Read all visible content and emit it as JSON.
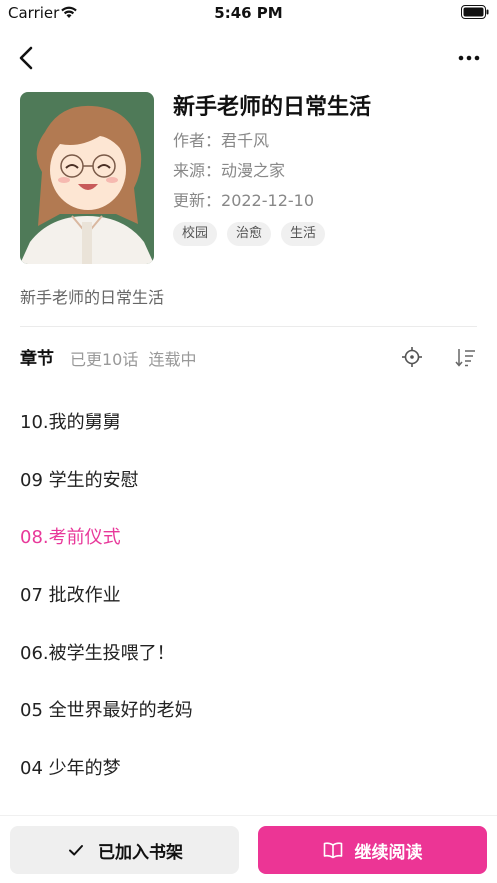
{
  "status_bar": {
    "carrier": "Carrier",
    "time": "5:46 PM",
    "wifi_icon": "wifi-icon",
    "battery_icon": "battery-icon"
  },
  "nav": {
    "back_icon": "chevron-left-icon",
    "more_icon": "more-horizontal-icon"
  },
  "book": {
    "title": "新手老师的日常生活",
    "author_label": "作者：",
    "author": "君千风",
    "source_label": "来源：",
    "source": "动漫之家",
    "updated_label": "更新：",
    "updated": "2022-12-10",
    "tags": [
      "校园",
      "治愈",
      "生活"
    ],
    "synopsis": "新手老师的日常生活"
  },
  "chapters": {
    "heading": "章节",
    "meta": "已更10话  连载中",
    "items": [
      "10.我的舅舅",
      "09 学生的安慰",
      "08.考前仪式",
      "07 批改作业",
      "06.被学生投喂了！",
      "05 全世界最好的老妈",
      "04 少年的梦"
    ],
    "active_index": 2
  },
  "actions": {
    "shelf_label": "已加入书架",
    "read_label": "继续阅读"
  },
  "colors": {
    "accent": "#ec3595",
    "active_chapter": "#e8389a",
    "cover_bg": "#4f7a58"
  }
}
